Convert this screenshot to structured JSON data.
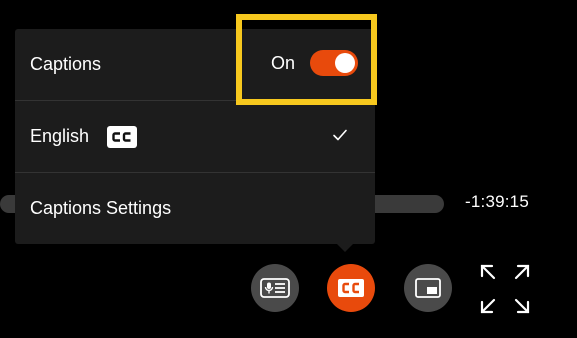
{
  "menu": {
    "captions_label": "Captions",
    "toggle_state_text": "On",
    "language_label": "English",
    "language_badge": "CC",
    "settings_label": "Captions Settings"
  },
  "player": {
    "time_remaining": "-1:39:15"
  },
  "controls": {
    "transcript_icon": "transcript-icon",
    "cc_icon": "closed-captions-icon",
    "pip_icon": "picture-in-picture-icon",
    "fullscreen_icon": "fullscreen-icon"
  },
  "colors": {
    "accent": "#e84a0c",
    "highlight": "#f7c81e",
    "menu_bg": "#1c1c1c",
    "button_bg": "#4a4a4a"
  }
}
